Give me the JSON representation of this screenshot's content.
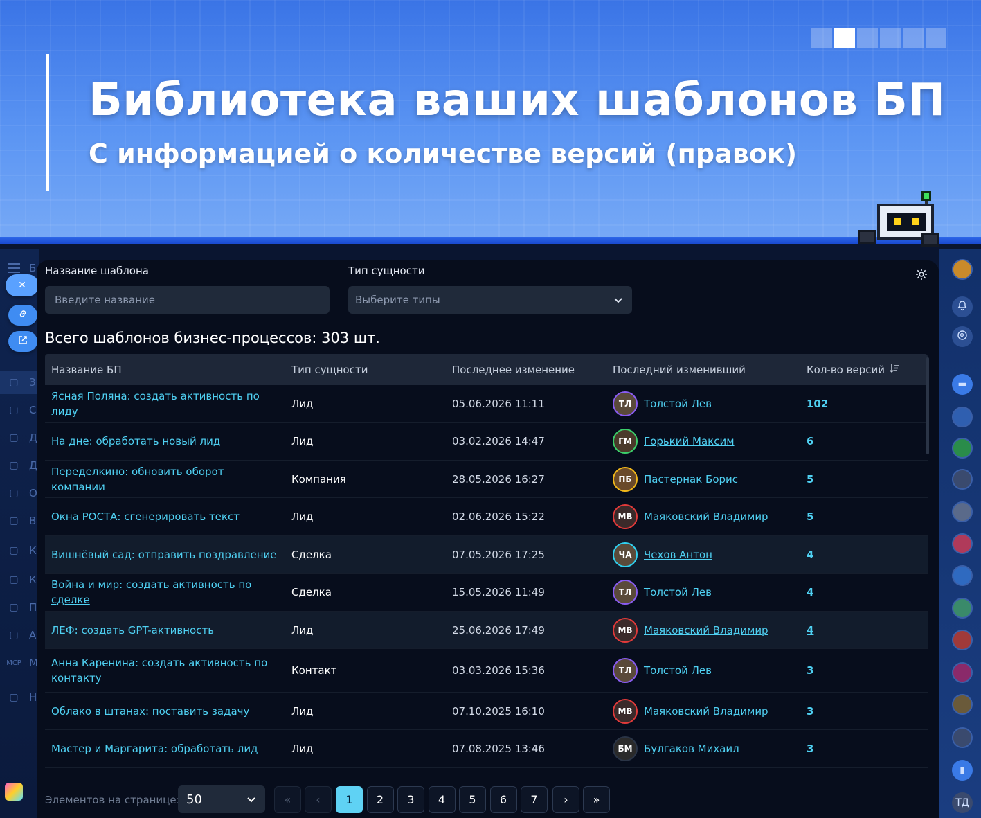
{
  "banner": {
    "title": "Библиотека ваших шаблонов БП",
    "subtitle": "С информацией о количестве версий (правок)",
    "slides": {
      "count": 6,
      "active": 2
    }
  },
  "filters": {
    "name_label": "Название шаблона",
    "name_placeholder": "Введите название",
    "type_label": "Тип сущности",
    "type_placeholder": "Выберите типы"
  },
  "summary": "Всего шаблонов бизнес-процессов: 303 шт.",
  "table": {
    "headers": [
      "Название БП",
      "Тип сущности",
      "Последнее изменение",
      "Последний изменивший",
      "Кол-во версий"
    ],
    "rows": [
      {
        "name": "Ясная Поляна: создать активность по лиду",
        "type": "Лид",
        "date": "05.06.2026 11:11",
        "user": "Толстой Лев",
        "initials": "ТЛ",
        "count": "102"
      },
      {
        "name": "На дне: обработать новый лид",
        "type": "Лид",
        "date": "03.02.2026 14:47",
        "user": "Горький Максим",
        "initials": "ГМ",
        "count": "6"
      },
      {
        "name": "Переделкино: обновить оборот компании",
        "type": "Компания",
        "date": "28.05.2026 16:27",
        "user": "Пастернак Борис",
        "initials": "ПБ",
        "count": "5"
      },
      {
        "name": "Окна РОСТА: сгенерировать текст",
        "type": "Лид",
        "date": "02.06.2026 15:22",
        "user": "Маяковский Владимир",
        "initials": "МВ",
        "count": "5"
      },
      {
        "name": "Вишнёвый сад: отправить поздравление",
        "type": "Сделка",
        "date": "07.05.2026 17:25",
        "user": "Чехов Антон",
        "initials": "ЧА",
        "count": "4"
      },
      {
        "name": "Война и мир: создать активность по сделке",
        "type": "Сделка",
        "date": "15.05.2026 11:49",
        "user": "Толстой Лев",
        "initials": "ТЛ",
        "count": "4"
      },
      {
        "name": "ЛЕФ: создать GPT-активность",
        "type": "Лид",
        "date": "25.06.2026 17:49",
        "user": "Маяковский Владимир",
        "initials": "МВ",
        "count": "4"
      },
      {
        "name": "Анна Каренина: создать активность по контакту",
        "type": "Контакт",
        "date": "03.03.2026 15:36",
        "user": "Толстой Лев",
        "initials": "ТЛ",
        "count": "3"
      },
      {
        "name": "Облако в штанах: поставить задачу",
        "type": "Лид",
        "date": "07.10.2025 16:10",
        "user": "Маяковский Владимир",
        "initials": "МВ",
        "count": "3"
      },
      {
        "name": "Мастер и Маргарита: обработать лид",
        "type": "Лид",
        "date": "07.08.2025 13:46",
        "user": "Булгаков Михаил",
        "initials": "БМ",
        "count": "3"
      }
    ]
  },
  "pagination": {
    "per_page_label": "Элементов на странице:",
    "per_page_value": "50",
    "first": "«",
    "prev": "‹",
    "pages": [
      "1",
      "2",
      "3",
      "4",
      "5",
      "6",
      "7"
    ],
    "active_page": "1",
    "next": "›",
    "last": "»"
  },
  "left_sidebar": {
    "menu_letters": [
      "Б",
      "З",
      "С",
      "Д",
      "Д",
      "О",
      "В",
      "К",
      "К",
      "П",
      "А",
      "М",
      "Н"
    ],
    "mcp_label": "MCP"
  },
  "right_sidebar": {
    "user_initials": "ТД"
  },
  "colors": {
    "accent": "#4fd0f2",
    "panel": "#070d1c",
    "banner": "#4d88f0",
    "active_page": "#5fd2f4"
  }
}
